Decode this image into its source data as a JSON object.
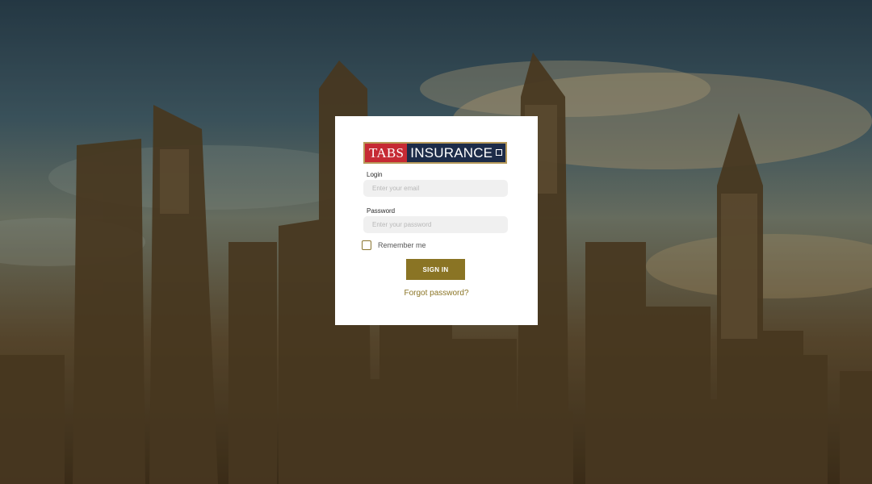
{
  "brand": {
    "logo_left": "TABS",
    "logo_right": "INSURANCE"
  },
  "form": {
    "login_label": "Login",
    "email_placeholder": "Enter your email",
    "email_value": "",
    "password_label": "Password",
    "password_placeholder": "Enter your password",
    "password_value": "",
    "remember_label": "Remember me",
    "remember_checked": false,
    "signin_label": "SIGN IN",
    "forgot_label": "Forgot password?"
  },
  "colors": {
    "accent": "#8a7424",
    "logo_red": "#c62a34",
    "logo_navy": "#1d2c49"
  },
  "icons": {
    "checkbox": "checkbox-unchecked-icon"
  }
}
